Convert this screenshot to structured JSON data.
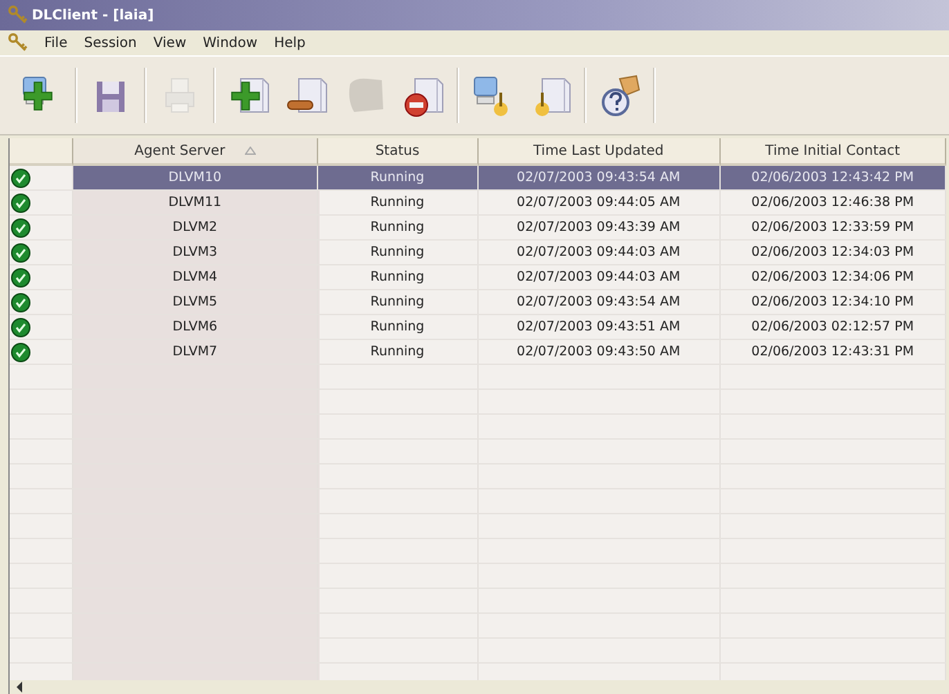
{
  "window": {
    "title": "DLClient - [laia]"
  },
  "menu": [
    "File",
    "Session",
    "View",
    "Window",
    "Help"
  ],
  "toolbar": [
    {
      "buttons": [
        {
          "kind": "add-computer",
          "disabled": false
        }
      ]
    },
    {
      "buttons": [
        {
          "kind": "save",
          "disabled": false
        }
      ]
    },
    {
      "buttons": [
        {
          "kind": "print",
          "disabled": true
        }
      ]
    },
    {
      "buttons": [
        {
          "kind": "add-server",
          "disabled": false
        },
        {
          "kind": "remove-server",
          "disabled": false
        },
        {
          "kind": "blank",
          "disabled": true
        },
        {
          "kind": "stop-server",
          "disabled": false
        }
      ]
    },
    {
      "buttons": [
        {
          "kind": "computer-download",
          "disabled": false
        },
        {
          "kind": "server-download",
          "disabled": false
        }
      ]
    },
    {
      "buttons": [
        {
          "kind": "help",
          "disabled": false
        }
      ]
    }
  ],
  "table": {
    "columns": [
      {
        "label": "Agent Server",
        "sorted": true
      },
      {
        "label": "Status",
        "sorted": false
      },
      {
        "label": "Time Last Updated",
        "sorted": false
      },
      {
        "label": "Time Initial Contact",
        "sorted": false
      }
    ],
    "rows": [
      {
        "selected": true,
        "cells": [
          "DLVM10",
          "Running",
          "02/07/2003 09:43:54 AM",
          "02/06/2003 12:43:42 PM"
        ]
      },
      {
        "selected": false,
        "cells": [
          "DLVM11",
          "Running",
          "02/07/2003 09:44:05 AM",
          "02/06/2003 12:46:38 PM"
        ]
      },
      {
        "selected": false,
        "cells": [
          "DLVM2",
          "Running",
          "02/07/2003 09:43:39 AM",
          "02/06/2003 12:33:59 PM"
        ]
      },
      {
        "selected": false,
        "cells": [
          "DLVM3",
          "Running",
          "02/07/2003 09:44:03 AM",
          "02/06/2003 12:34:03 PM"
        ]
      },
      {
        "selected": false,
        "cells": [
          "DLVM4",
          "Running",
          "02/07/2003 09:44:03 AM",
          "02/06/2003 12:34:06 PM"
        ]
      },
      {
        "selected": false,
        "cells": [
          "DLVM5",
          "Running",
          "02/07/2003 09:43:54 AM",
          "02/06/2003 12:34:10 PM"
        ]
      },
      {
        "selected": false,
        "cells": [
          "DLVM6",
          "Running",
          "02/07/2003 09:43:51 AM",
          "02/06/2003 02:12:57 PM"
        ]
      },
      {
        "selected": false,
        "cells": [
          "DLVM7",
          "Running",
          "02/07/2003 09:43:50 AM",
          "02/06/2003 12:43:31 PM"
        ]
      }
    ]
  }
}
